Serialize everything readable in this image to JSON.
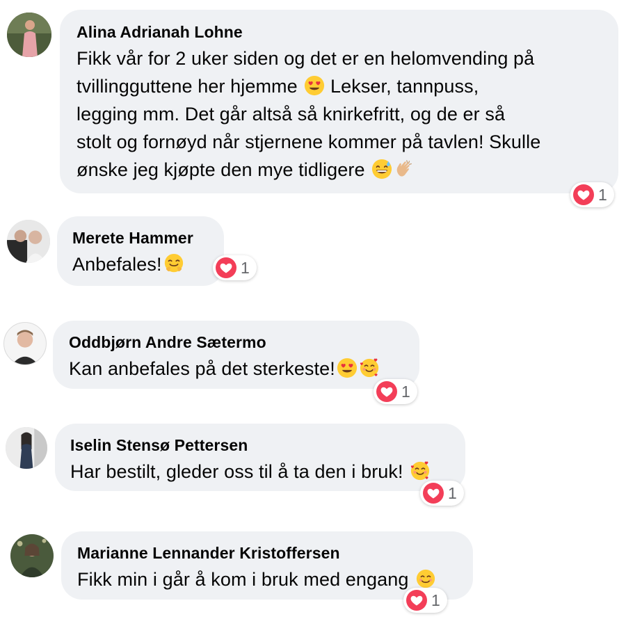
{
  "comments": [
    {
      "author": "Alina Adrianah Lohne",
      "lines": [
        "Fikk vår for 2 uker siden og det er en helomvending på",
        "tvillingguttene her hjemme",
        "Lekser, tannpuss,",
        "legging mm. Det går altså så knirkefritt, og de er så",
        "stolt og fornøyd når stjernene kommer på tavlen! Skulle",
        "ønske jeg kjøpte den mye tidligere"
      ],
      "emojis": [
        "heart-eyes-emoji",
        "grinning-sweat-emoji",
        "clapping-hands-emoji"
      ],
      "reaction": {
        "type": "love",
        "count": "1"
      }
    },
    {
      "author": "Merete Hammer",
      "text": "Anbefales!",
      "emojis": [
        "hugging-face-emoji"
      ],
      "reaction": {
        "type": "love",
        "count": "1"
      }
    },
    {
      "author": "Oddbjørn Andre Sætermo",
      "text": "Kan anbefales på det sterkeste!",
      "emojis": [
        "heart-eyes-emoji",
        "smiling-face-with-hearts-emoji"
      ],
      "reaction": {
        "type": "love",
        "count": "1"
      }
    },
    {
      "author": "Iselin Stensø Pettersen",
      "text": "Har bestilt, gleder oss til å ta den i bruk!",
      "emojis": [
        "smiling-face-with-hearts-emoji"
      ],
      "reaction": {
        "type": "love",
        "count": "1"
      }
    },
    {
      "author": "Marianne Lennander Kristoffersen",
      "text": "Fikk min i går å kom i bruk med engang",
      "emojis": [
        "smiling-face-emoji"
      ],
      "reaction": {
        "type": "love",
        "count": "1"
      }
    }
  ],
  "colors": {
    "bubble": "#eff1f4",
    "love": "#f33e58",
    "count": "#65676b",
    "emoji_face": "#ffcc33"
  }
}
